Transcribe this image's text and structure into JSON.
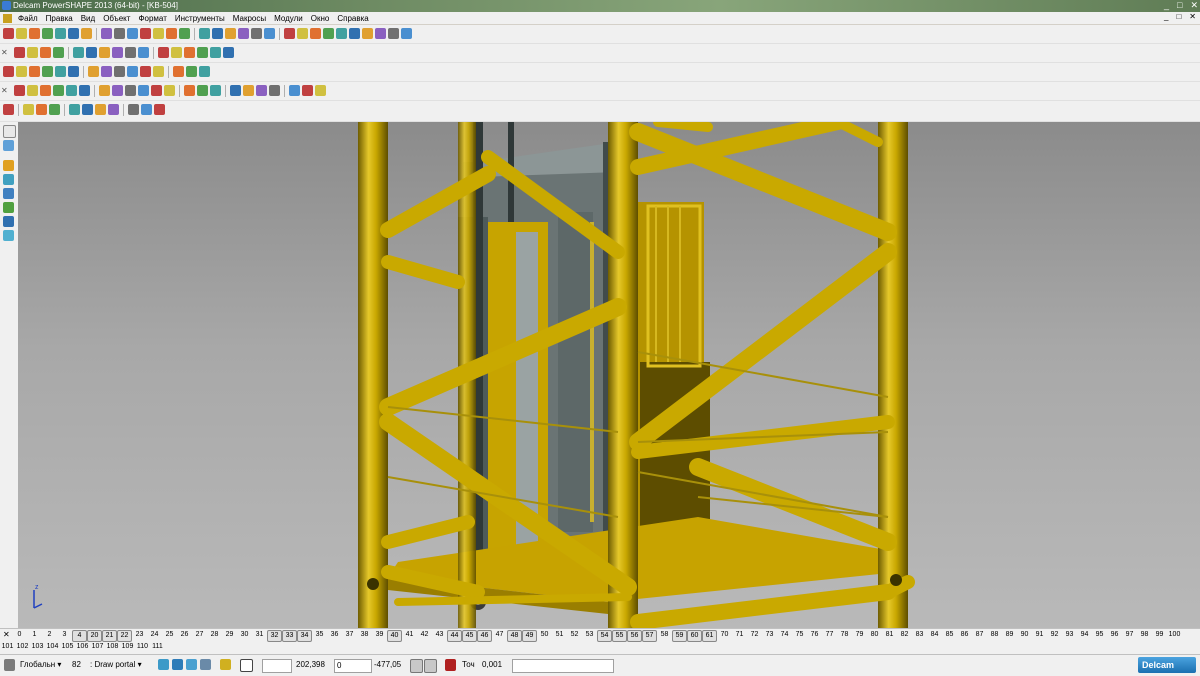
{
  "window": {
    "title": "Delcam PowerSHAPE 2013 (64-bit) - [KB-504]",
    "controls": [
      "_",
      "□",
      "✕"
    ]
  },
  "menu": {
    "items": [
      "Файл",
      "Правка",
      "Вид",
      "Объект",
      "Формат",
      "Инструменты",
      "Макросы",
      "Модули",
      "Окно",
      "Справка"
    ],
    "mdi_controls": [
      "_",
      "□",
      "✕"
    ]
  },
  "levels": {
    "row1": [
      "0",
      "1",
      "2",
      "3",
      "4",
      "20",
      "21",
      "22",
      "23",
      "24",
      "25",
      "26",
      "27",
      "28",
      "29",
      "30",
      "31",
      "32",
      "33",
      "34",
      "35",
      "36",
      "37",
      "38",
      "39",
      "40",
      "41",
      "42",
      "43",
      "44",
      "45",
      "46",
      "47",
      "48",
      "49",
      "50",
      "51",
      "52",
      "53",
      "54",
      "55",
      "56",
      "57",
      "58",
      "59",
      "60",
      "61",
      "70",
      "71",
      "72",
      "73",
      "74",
      "75",
      "76",
      "77",
      "78",
      "79",
      "80",
      "81",
      "82",
      "83",
      "84",
      "85",
      "86",
      "87",
      "88",
      "89",
      "90",
      "91",
      "92",
      "93",
      "94",
      "95",
      "96",
      "97",
      "98",
      "99",
      "100"
    ],
    "row1_boxed": [
      "4",
      "20",
      "21",
      "22",
      "32",
      "33",
      "34",
      "40",
      "44",
      "45",
      "46",
      "48",
      "49",
      "54",
      "55",
      "56",
      "57",
      "59",
      "60",
      "61"
    ],
    "row2": [
      "101",
      "102",
      "103",
      "104",
      "105",
      "106",
      "107",
      "108",
      "109",
      "110",
      "111"
    ]
  },
  "status": {
    "workplane": "Глобальн",
    "level_number": "82",
    "level_name": "Draw portal",
    "x": "202,398",
    "y": "0",
    "z": "-477,05",
    "tolerance_label": "Точ",
    "tolerance": "0,001",
    "brand": "Delcam"
  },
  "colors": {
    "steel": "#c8a800",
    "steel_dark": "#8a7200",
    "panel": "#c9a400",
    "glass": "#5a6a6a"
  }
}
